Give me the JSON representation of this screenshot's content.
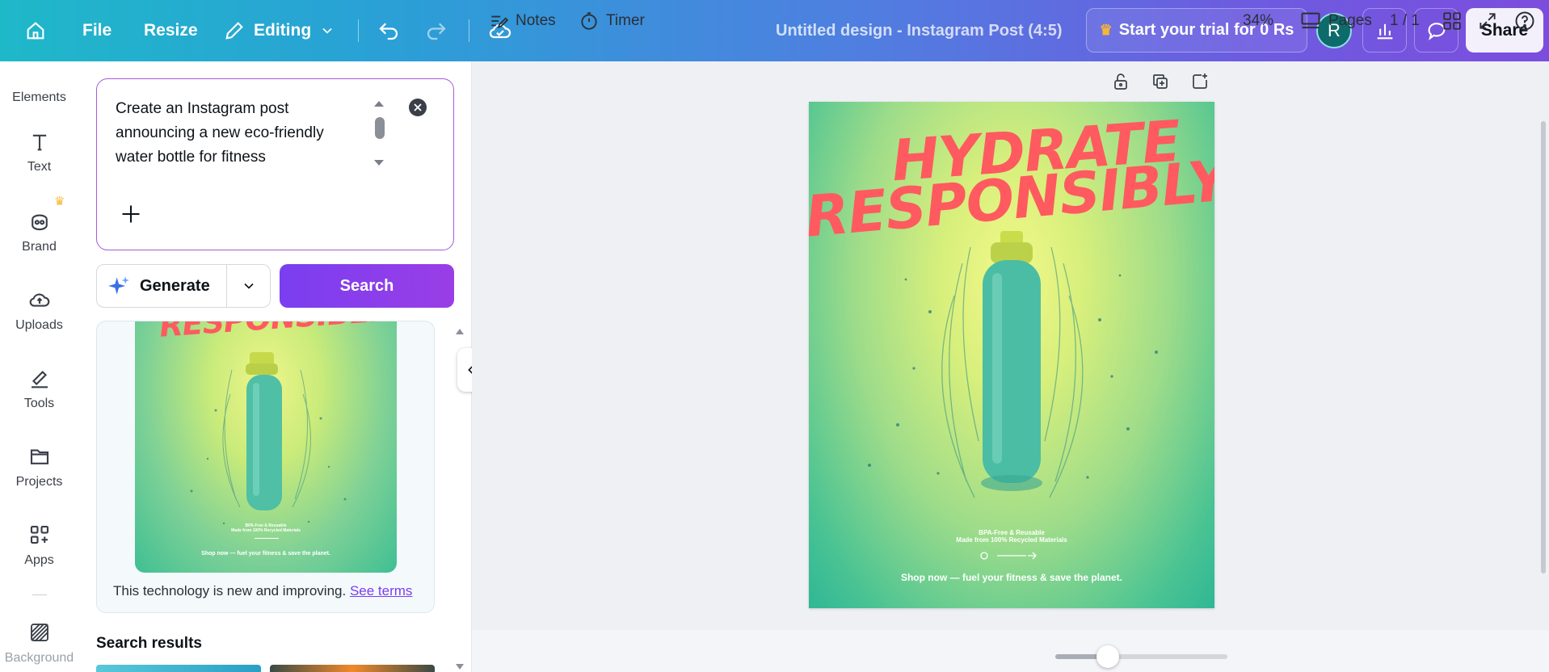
{
  "topbar": {
    "file": "File",
    "resize": "Resize",
    "editing": "Editing",
    "doc_title": "Untitled design - Instagram Post (4:5)",
    "trial": "Start your trial for 0 Rs",
    "avatar_letter": "R",
    "share": "Share"
  },
  "rail": {
    "items": [
      {
        "label": "Elements",
        "icon": "elements-icon"
      },
      {
        "label": "Text",
        "icon": "text-icon"
      },
      {
        "label": "Brand",
        "icon": "brand-icon"
      },
      {
        "label": "Uploads",
        "icon": "uploads-icon"
      },
      {
        "label": "Tools",
        "icon": "tools-icon"
      },
      {
        "label": "Projects",
        "icon": "folder-icon"
      },
      {
        "label": "Apps",
        "icon": "apps-icon"
      },
      {
        "label": "Background",
        "icon": "background-icon"
      }
    ]
  },
  "panel": {
    "prompt": "Create an Instagram post announcing a new eco-friendly water bottle for fitness",
    "generate": "Generate",
    "search": "Search",
    "disclaimer": "This technology is new and improving.",
    "see_terms": "See terms",
    "search_results": "Search results",
    "mini_poster": {
      "title": "RESPONSIBLY",
      "line1": "BPA-Free & Reusable",
      "line2": "Made from 100% Recycled Materials",
      "cta": "Shop now — fuel your fitness & save the planet."
    }
  },
  "poster": {
    "title_line1": "HYDRATE",
    "title_line2": "RESPONSIBLY",
    "line1": "BPA-Free & Reusable",
    "line2": "Made from 100% Recycled Materials",
    "cta": "Shop now — fuel your fitness & save the planet."
  },
  "bottombar": {
    "notes": "Notes",
    "timer": "Timer",
    "zoom": "34%",
    "zoom_level": 0.34,
    "pages": "Pages",
    "page_count": "1 / 1"
  },
  "colors": {
    "accent": "#7a3ef0",
    "title_red": "#ff5a5f",
    "bottle": "#45b8a0"
  }
}
